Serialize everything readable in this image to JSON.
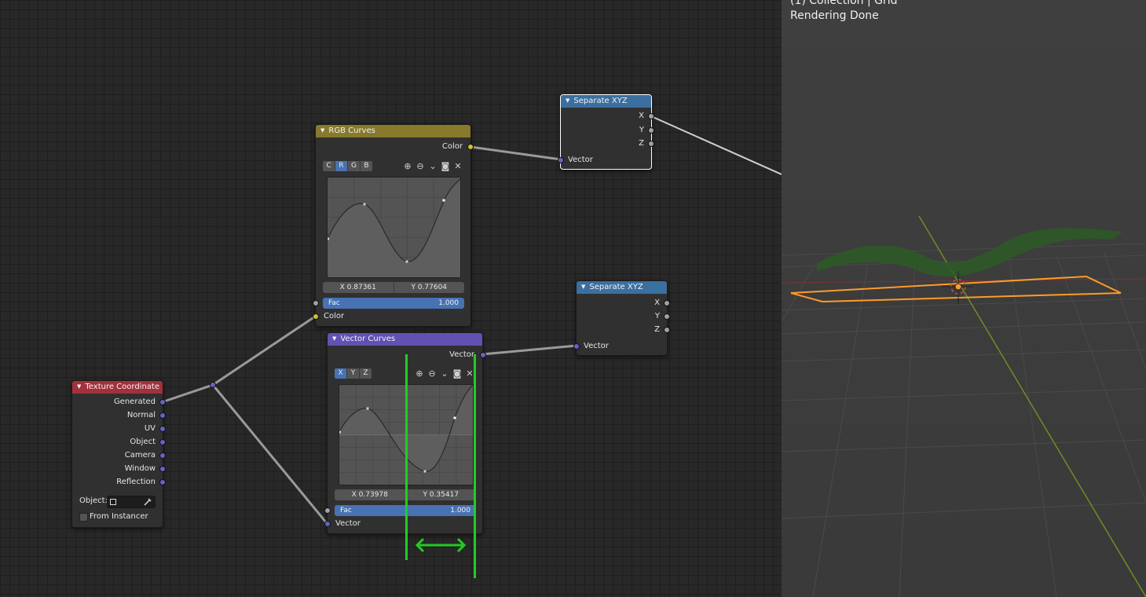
{
  "viewport": {
    "collection_text": "(1) Collection | Grid",
    "status_text": "Rendering Done"
  },
  "nodes": {
    "texture_coordinate": {
      "title": "Texture Coordinate",
      "outputs": [
        "Generated",
        "Normal",
        "UV",
        "Object",
        "Camera",
        "Window",
        "Reflection"
      ],
      "object_label": "Object:",
      "from_instancer_label": "From Instancer",
      "from_instancer_checked": false
    },
    "rgb_curves": {
      "title": "RGB Curves",
      "output_label": "Color",
      "channels": [
        "C",
        "R",
        "G",
        "B"
      ],
      "active_channel": "R",
      "x_readout": "X 0.87361",
      "y_readout": "Y 0.77604",
      "fac_label": "Fac",
      "fac_value": "1.000",
      "input_label": "Color"
    },
    "vector_curves": {
      "title": "Vector Curves",
      "output_label": "Vector",
      "channels": [
        "X",
        "Y",
        "Z"
      ],
      "active_channel": "X",
      "x_readout": "X 0.73978",
      "y_readout": "Y 0.35417",
      "fac_label": "Fac",
      "fac_value": "1.000",
      "input_label": "Vector"
    },
    "separate_xyz_top": {
      "title": "Separate XYZ",
      "outputs": [
        "X",
        "Y",
        "Z"
      ],
      "input_label": "Vector"
    },
    "separate_xyz_bottom": {
      "title": "Separate XYZ",
      "outputs": [
        "X",
        "Y",
        "Z"
      ],
      "input_label": "Vector"
    }
  },
  "tool_icons": [
    "zoom-in-icon",
    "zoom-out-icon",
    "chevron-down-icon",
    "clipping-icon",
    "close-icon"
  ],
  "colors": {
    "vector_socket": "#6363c7",
    "color_socket": "#c7c729",
    "value_socket": "#a1a1a1",
    "selection_outline": "#ff9b29",
    "annotation_green": "#22cc22"
  }
}
